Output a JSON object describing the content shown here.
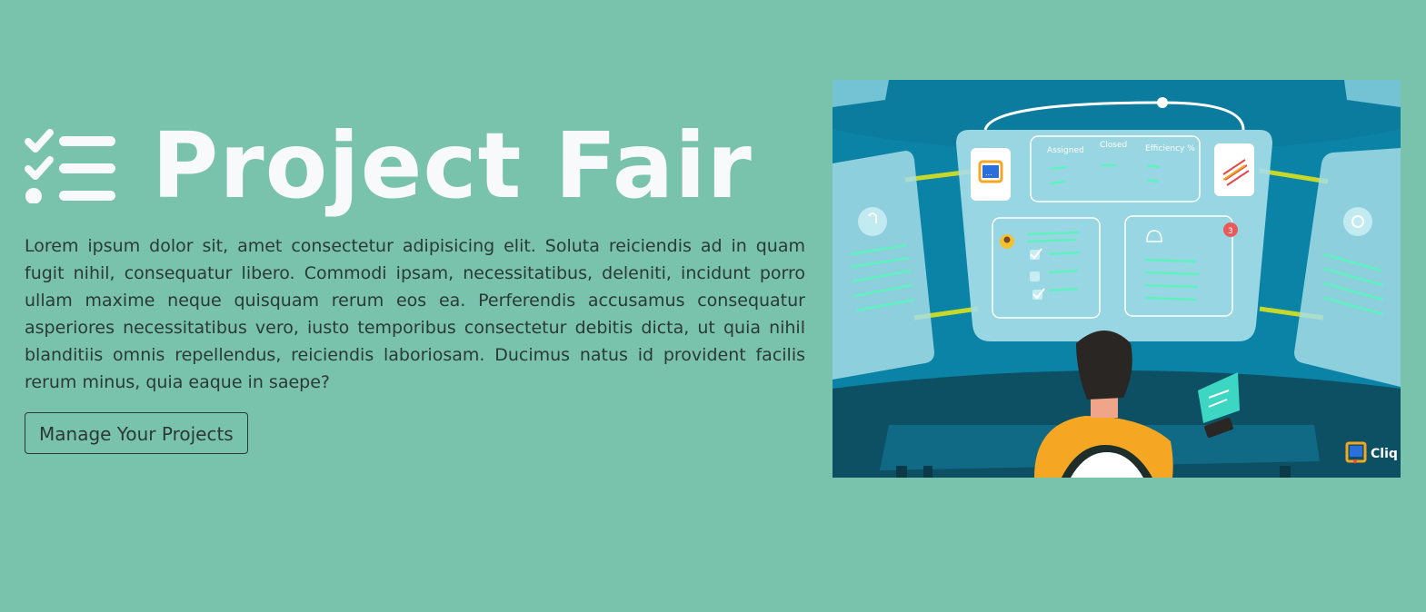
{
  "hero": {
    "title": "Project Fair",
    "title_icon": "checklist-icon",
    "description": "Lorem ipsum dolor sit, amet consectetur adipisicing elit. Soluta reiciendis ad in quam fugit nihil, consequatur libero. Commodi ipsam, necessitatibus, deleniti, incidunt porro ullam maxime neque quisquam rerum eos ea. Perferendis accusamus consequatur asperiores necessitatibus vero, iusto temporibus consectetur debitis dicta, ut quia nihil blanditiis omnis repellendus, reiciendis laboriosam. Ducimus natus id provident facilis rerum minus, quia eaque in saepe?",
    "cta_label": "Manage Your Projects"
  },
  "illustration": {
    "dashboard": {
      "col_assigned": "Assigned",
      "col_closed": "Closed",
      "col_efficiency": "Efficiency %",
      "notification_count": "3"
    },
    "brand_label": "Cliq"
  },
  "colors": {
    "background": "#79c2ac",
    "title": "#f7f9fa",
    "text": "#2b3a36",
    "scene_blue": "#0a83a6",
    "accent_green": "#5ff2bf",
    "accent_lime": "#c6d92b"
  }
}
